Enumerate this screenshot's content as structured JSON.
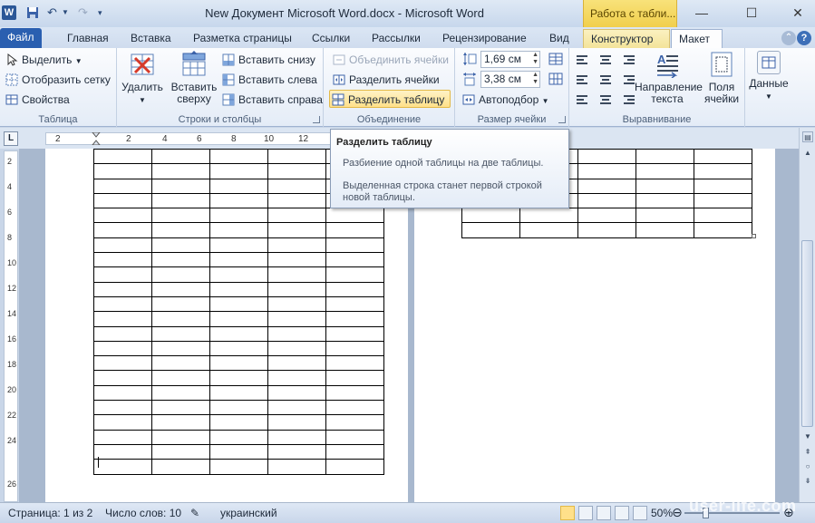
{
  "window": {
    "title": "New Документ Microsoft Word.docx  -  Microsoft Word",
    "context_group": "Работа с табли...",
    "app_icon": "W",
    "colors": {
      "file_tab": "#2a5fb0",
      "context_tab": "#f3e39a",
      "highlight": "#ffe08a"
    }
  },
  "tabs": {
    "file": "Файл",
    "home": "Главная",
    "insert": "Вставка",
    "layout_page": "Разметка страницы",
    "references": "Ссылки",
    "mailings": "Рассылки",
    "review": "Рецензирование",
    "view": "Вид",
    "design": "Конструктор",
    "layout": "Макет"
  },
  "ribbon": {
    "table_group": {
      "label": "Таблица",
      "select": "Выделить",
      "show_grid": "Отобразить сетку",
      "properties": "Свойства"
    },
    "rows_cols_group": {
      "label": "Строки и столбцы",
      "delete": "Удалить",
      "insert_above_1": "Вставить",
      "insert_above_2": "сверху",
      "insert_below": "Вставить снизу",
      "insert_left": "Вставить слева",
      "insert_right": "Вставить справа"
    },
    "merge_group": {
      "label": "Объединение",
      "merge_cells": "Объединить ячейки",
      "split_cells": "Разделить ячейки",
      "split_table": "Разделить таблицу"
    },
    "cell_size_group": {
      "label": "Размер ячейки",
      "height": "1,69 см",
      "width": "3,38 см",
      "autofit": "Автоподбор"
    },
    "alignment_group": {
      "label": "Выравнивание",
      "text_direction_1": "Направление",
      "text_direction_2": "текста",
      "cell_margins_1": "Поля",
      "cell_margins_2": "ячейки"
    },
    "data_group": {
      "data": "Данные"
    }
  },
  "ruler": {
    "corner": "L",
    "ticks": [
      "2",
      "2",
      "4",
      "6",
      "8",
      "10",
      "12"
    ],
    "vticks": [
      "2",
      "4",
      "6",
      "8",
      "10",
      "12",
      "14",
      "16",
      "18",
      "20",
      "22",
      "24",
      "26"
    ]
  },
  "tooltip": {
    "title": "Разделить таблицу",
    "description": "Разбиение одной таблицы на две таблицы.",
    "note": "Выделенная строка станет первой строкой новой таблицы."
  },
  "document": {
    "left_table": {
      "rows": 22,
      "cols": 5
    },
    "right_table": {
      "rows": 6,
      "cols": 5
    }
  },
  "statusbar": {
    "page": "Страница: 1 из 2",
    "words": "Число слов: 10",
    "language": "украинский",
    "zoom": "50%",
    "zoom_level": 0.5
  },
  "watermark": "user-life.com"
}
